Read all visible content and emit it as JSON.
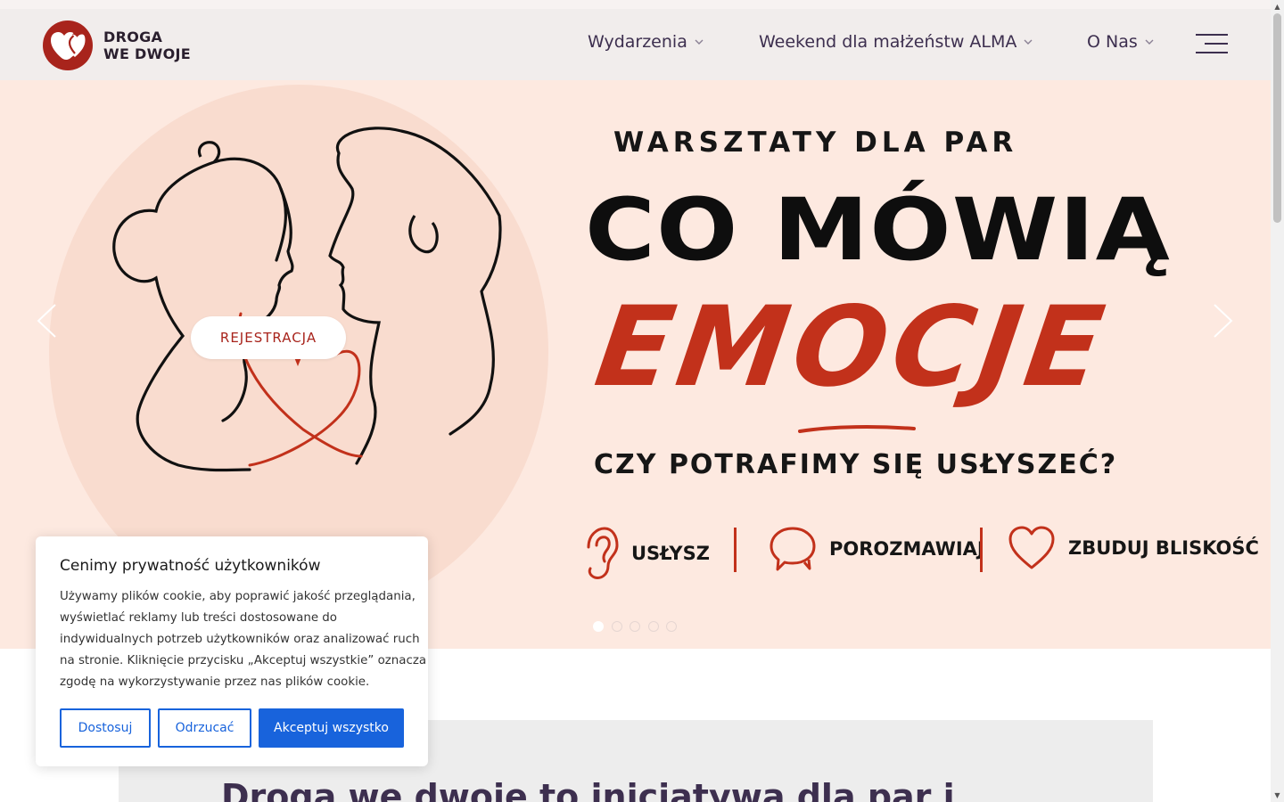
{
  "brand": {
    "name_line1": "DROGA",
    "name_line2": "WE DWOJE",
    "logo_icon": "double-heart-logo",
    "color": "#a8241c"
  },
  "nav": {
    "items": [
      {
        "label": "Wydarzenia"
      },
      {
        "label": "Weekend dla małżeństw ALMA"
      },
      {
        "label": "O Nas"
      }
    ],
    "menu_icon": "hamburger-menu-icon"
  },
  "hero": {
    "subtitle": "WARSZTATY DLA PAR",
    "title": "CO MÓWIĄ",
    "accent": "EMOCJE",
    "question": "CZY POTRAFIMY SIĘ USŁYSZEĆ?",
    "features": [
      {
        "icon": "ear-icon",
        "label": "USŁYSZ"
      },
      {
        "icon": "speech-bubble-icon",
        "label": "POROZMAWIAJ"
      },
      {
        "icon": "heart-icon",
        "label": "ZBUDUJ BLISKOŚĆ"
      }
    ],
    "cta_label": "REJESTRACJA",
    "slides_count": 5,
    "active_slide": 1,
    "accent_color": "#c2311b",
    "background": "#fde9e0"
  },
  "intro": {
    "heading": "Droga we dwoje to inicjatywa dla par i"
  },
  "cookie": {
    "title": "Cenimy prywatność użytkowników",
    "text_lines": [
      "Używamy plików cookie, aby poprawić jakość przeglądania,",
      "wyświetlać reklamy lub treści dostosowane do",
      "indywidualnych potrzeb użytkowników oraz analizować ruch",
      "na stronie. Kliknięcie przycisku „Akceptuj wszystkie” oznacza",
      "zgodę na wykorzystywanie przez nas plików cookie."
    ],
    "btn_customize": "Dostosuj",
    "btn_reject": "Odrzucać",
    "btn_accept": "Akceptuj wszystko",
    "button_color": "#1863dc"
  }
}
